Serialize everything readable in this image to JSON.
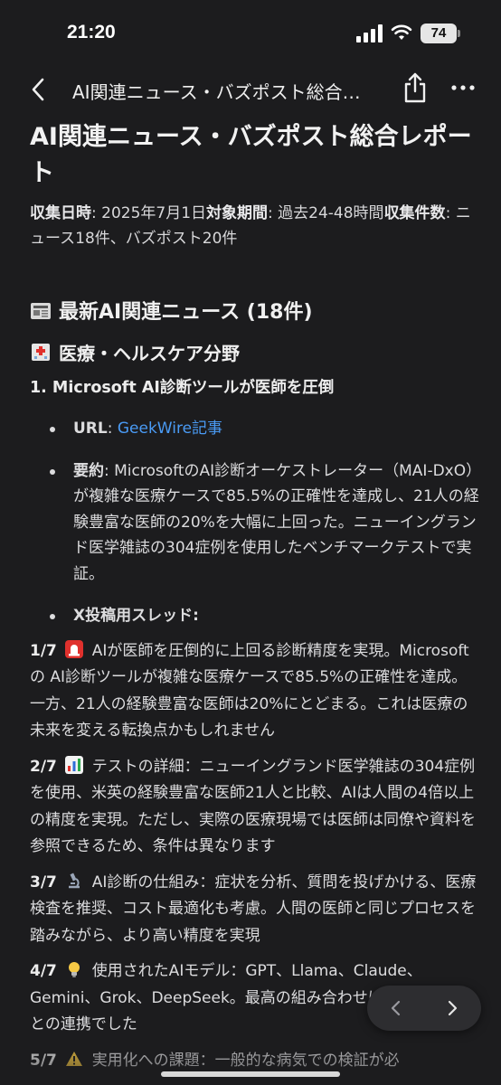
{
  "status_bar": {
    "time": "21:20",
    "battery": "74"
  },
  "nav": {
    "title": "AI関連ニュース・バズポスト総合…"
  },
  "doc": {
    "title": "AI関連ニュース・バズポスト総合レポート",
    "meta_collected_label": "収集日時",
    "meta_collected_value": ": 2025年7月1日",
    "meta_period_label": "対象期間",
    "meta_period_value": ": 過去24-48時間",
    "meta_count_label": "収集件数",
    "meta_count_value": ": ニュース18件、バズポスト20件",
    "news_heading": "最新AI関連ニュース (18件)",
    "medical_heading": "医療・ヘルスケア分野",
    "item1_title": "1. Microsoft AI診断ツールが医師を圧倒",
    "url_label": "URL",
    "url_sep": ": ",
    "url_link": "GeekWire記事",
    "summary_label": "要約",
    "summary_text": ": MicrosoftのAI診断オーケストレーター（MAI-DxO）が複雑な医療ケースで85.5%の正確性を達成し、21人の経験豊富な医師の20%を大幅に上回った。ニューイングランド医学雑誌の304症例を使用したベンチマークテストで実証。",
    "thread_label": "X投稿用スレッド",
    "thread_suffix": ":",
    "posts": [
      {
        "num": "1/7",
        "emoji": "rotating-light",
        "text": "AIが医師を圧倒的に上回る診断精度を実現。Microsoftの AI診断ツールが複雑な医療ケースで85.5%の正確性を達成。一方、21人の経験豊富な医師は20%にとどまる。これは医療の未来を変える転換点かもしれません"
      },
      {
        "num": "2/7",
        "emoji": "bar-chart",
        "text": "テストの詳細：ニューイングランド医学雑誌の304症例を使用、米英の経験豊富な医師21人と比較、AIは人間の4倍以上の精度を実現。ただし、実際の医療現場では医師は同僚や資料を参照できるため、条件は異なります"
      },
      {
        "num": "3/7",
        "emoji": "microscope",
        "text": "AI診断の仕組み：症状を分析、質問を投げかける、医療検査を推奨、コスト最適化も考慮。人間の医師と同じプロセスを踏みながら、より高い精度を実現"
      },
      {
        "num": "4/7",
        "emoji": "light-bulb",
        "text": "使用されたAIモデル：GPT、Llama、Claude、Gemini、Grok、DeepSeek。最高の組み合わせはOpenAIのo3との連携でした"
      },
      {
        "num": "5/7",
        "emoji": "warning",
        "text": "実用化への課題：一般的な病気での検証が必"
      }
    ]
  },
  "colors": {
    "background": "#1c1c1e",
    "link": "#4a9bf5",
    "text": "#dcdcde"
  }
}
